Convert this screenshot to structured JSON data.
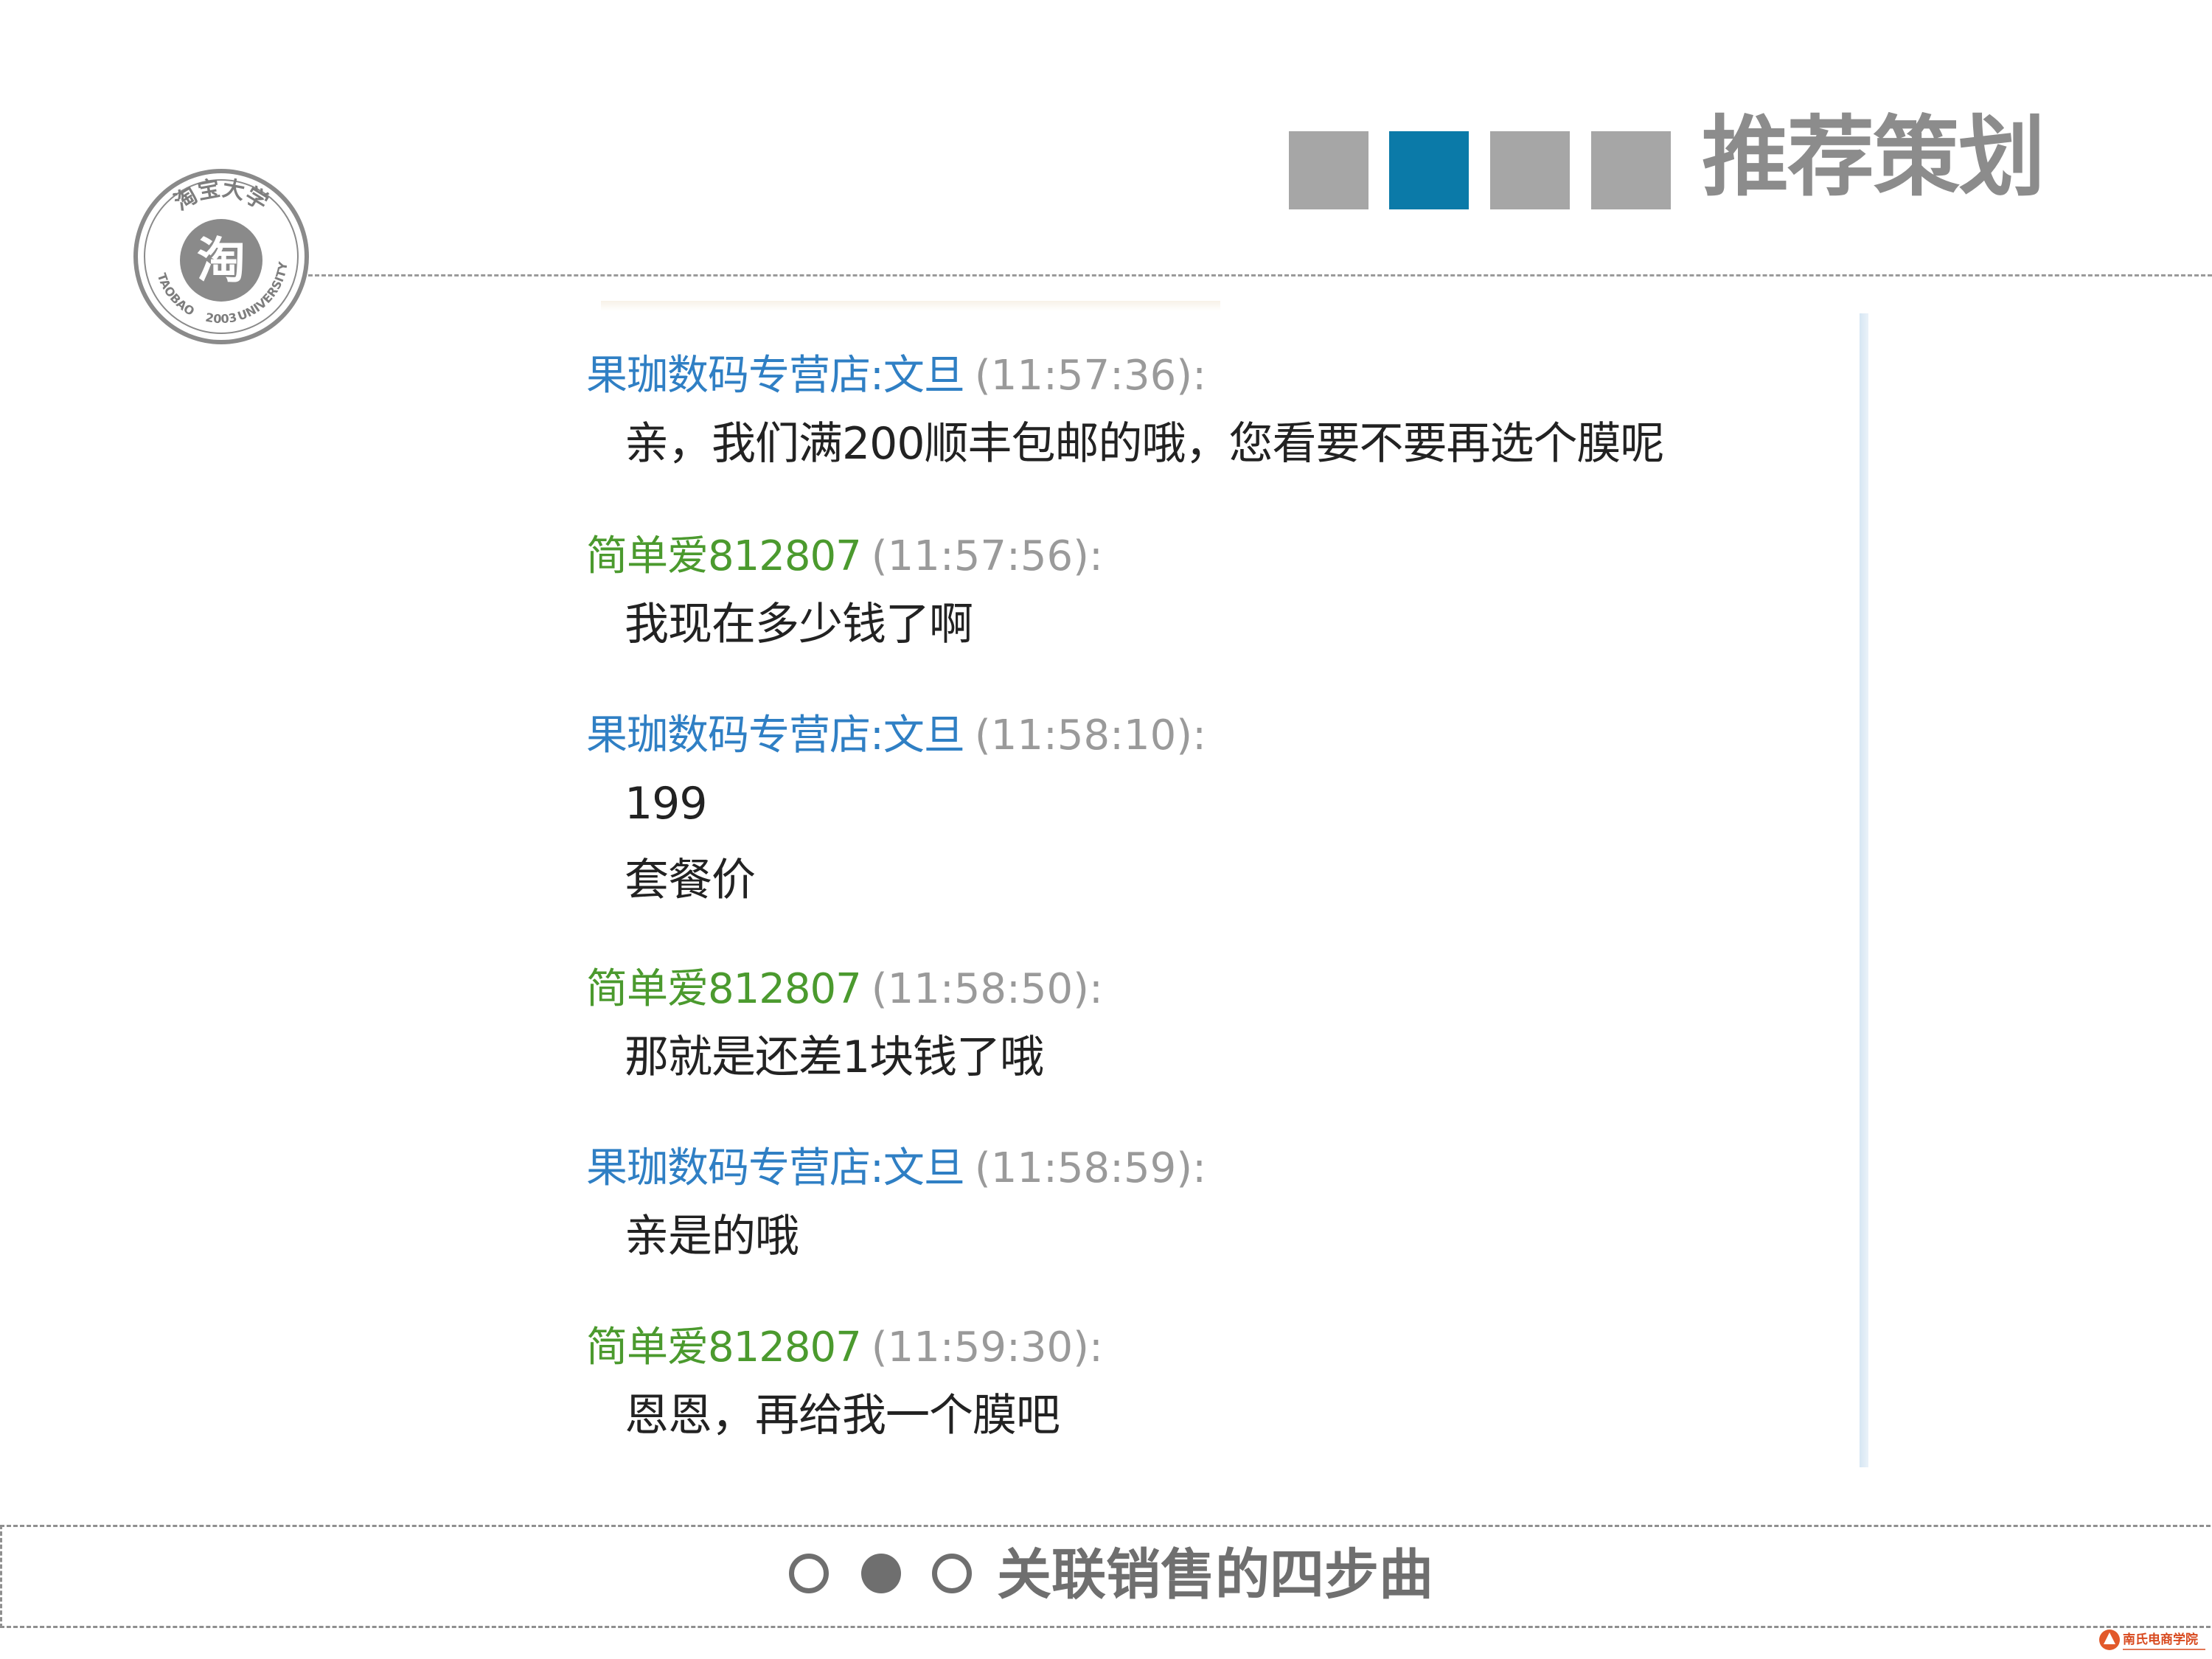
{
  "header": {
    "title": "推荐策划",
    "step_squares": [
      {
        "state": "inactive"
      },
      {
        "state": "active"
      },
      {
        "state": "inactive"
      },
      {
        "state": "inactive"
      }
    ],
    "colors": {
      "square_active": "#0b7aa8",
      "square_inactive": "#a6a6a6",
      "title": "#8c8c8c"
    }
  },
  "logo": {
    "icon": "taobao-university-seal-icon",
    "arc_top": "淘宝大学",
    "center_glyph": "淘",
    "arc_left": "TAOBAO",
    "arc_right": "UNIVERSITY",
    "year": "2003"
  },
  "chat": {
    "messages": [
      {
        "sender": "果珈数码专营店:文旦",
        "time": "(11:57:36):",
        "role": "shop",
        "lines": [
          "亲，我们满200顺丰包邮的哦，您看要不要再选个膜呢"
        ]
      },
      {
        "sender": "简单爱812807",
        "time": "(11:57:56):",
        "role": "buyer",
        "lines": [
          "我现在多少钱了啊"
        ]
      },
      {
        "sender": "果珈数码专营店:文旦",
        "time": "(11:58:10):",
        "role": "shop",
        "lines": [
          "199",
          "套餐价"
        ]
      },
      {
        "sender": "简单爱812807",
        "time": "(11:58:50):",
        "role": "buyer",
        "lines": [
          "那就是还差1块钱了哦"
        ]
      },
      {
        "sender": "果珈数码专营店:文旦",
        "time": "(11:58:59):",
        "role": "shop",
        "lines": [
          "亲是的哦"
        ]
      },
      {
        "sender": "简单爱812807",
        "time": "(11:59:30):",
        "role": "buyer",
        "lines": [
          "恩恩，再给我一个膜吧"
        ]
      }
    ],
    "colors": {
      "shop_sender": "#2f7fc4",
      "buyer_sender": "#4b9a2e",
      "time": "#9a9a9a"
    }
  },
  "footer": {
    "title": "关联销售的四步曲",
    "dots": [
      {
        "state": "hollow"
      },
      {
        "state": "filled"
      },
      {
        "state": "hollow"
      }
    ]
  },
  "corner_logo": {
    "icon": "school-logo-icon",
    "text": "南氏电商学院"
  }
}
